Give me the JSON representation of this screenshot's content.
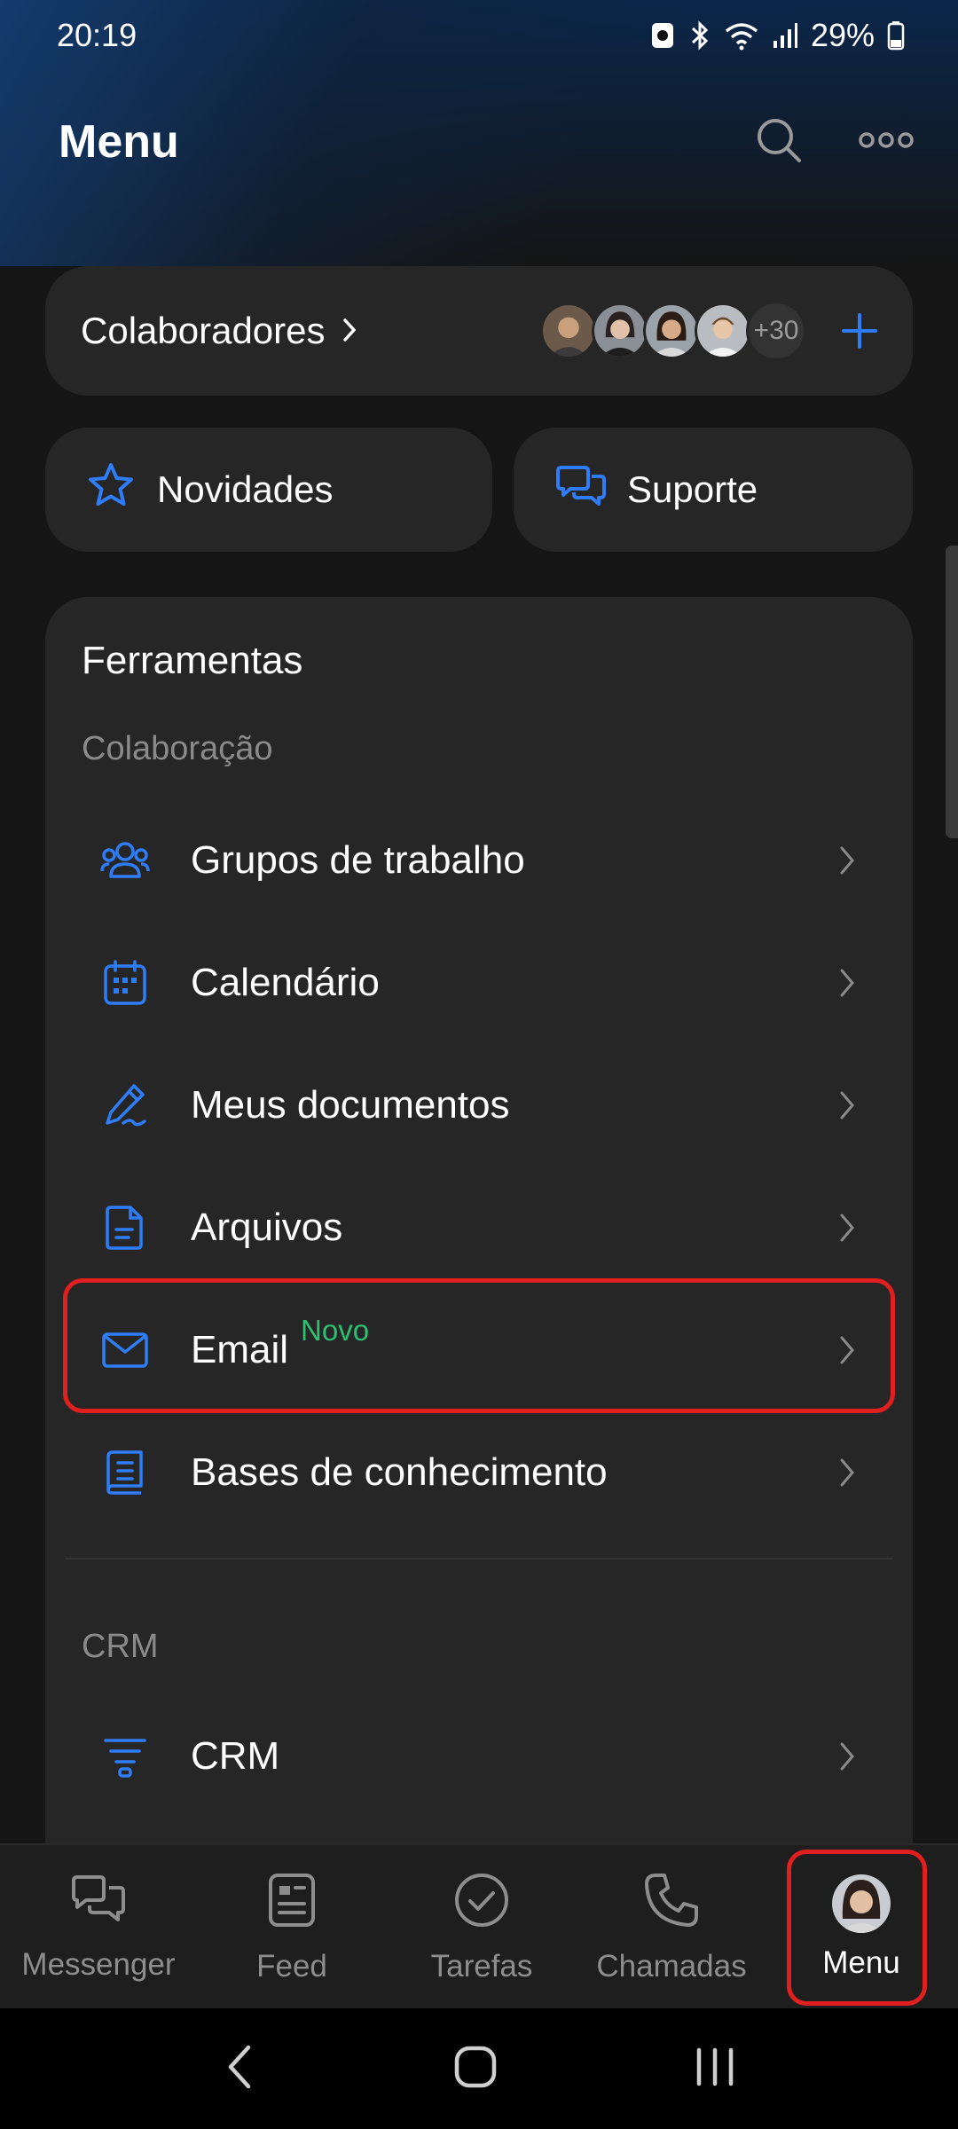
{
  "status_bar": {
    "time": "20:19",
    "battery": "29%"
  },
  "header": {
    "title": "Menu"
  },
  "collaborators": {
    "label": "Colaboradores",
    "more_count": "+30"
  },
  "quick_links": {
    "news": "Novidades",
    "support": "Suporte"
  },
  "tools": {
    "title": "Ferramentas",
    "sections": [
      {
        "label": "Colaboração",
        "items": [
          {
            "label": "Grupos de trabalho",
            "icon": "people-icon"
          },
          {
            "label": "Calendário",
            "icon": "calendar-icon"
          },
          {
            "label": "Meus documentos",
            "icon": "pen-icon"
          },
          {
            "label": "Arquivos",
            "icon": "file-icon"
          },
          {
            "label": "Email",
            "icon": "mail-icon",
            "badge": "Novo"
          },
          {
            "label": "Bases de conhecimento",
            "icon": "book-icon"
          }
        ]
      },
      {
        "label": "CRM",
        "items": [
          {
            "label": "CRM",
            "icon": "funnel-icon"
          }
        ]
      }
    ]
  },
  "bottom_nav": [
    {
      "label": "Messenger",
      "icon": "chat-icon"
    },
    {
      "label": "Feed",
      "icon": "feed-icon"
    },
    {
      "label": "Tarefas",
      "icon": "check-circle-icon"
    },
    {
      "label": "Chamadas",
      "icon": "phone-icon"
    },
    {
      "label": "Menu",
      "icon": "avatar",
      "active": true
    }
  ],
  "colors": {
    "accent": "#2f7df6",
    "highlight": "#e0201f",
    "badge": "#2fbf71"
  }
}
